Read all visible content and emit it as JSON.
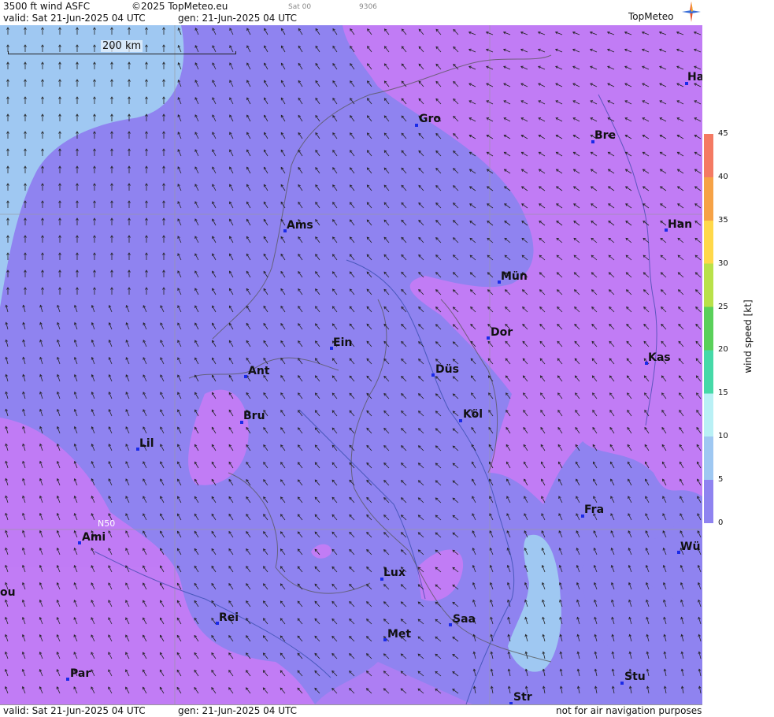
{
  "header": {
    "title": "3500 ft wind ASFC",
    "copyright": "©2025 TopMeteo.eu",
    "mini_day": "Sat 00",
    "mini_code": "9306",
    "valid": "valid:  Sat  21-Jun-2025  04 UTC",
    "gen": "gen:  21-Jun-2025 04 UTC",
    "logo": "TopMeteo"
  },
  "footer": {
    "valid": "valid:  Sat  21-Jun-2025  04 UTC",
    "gen": "gen:  21-Jun-2025 04 UTC",
    "disclaimer": "not for air navigation purposes"
  },
  "scale_bar": {
    "label": "200 km"
  },
  "grid_label": "N50",
  "legend": {
    "title": "wind  speed  [kt]",
    "ticks": [
      "45",
      "40",
      "35",
      "30",
      "25",
      "20",
      "15",
      "10",
      "5",
      "0"
    ],
    "colors": [
      "#f47a63",
      "#f6a246",
      "#ffd84a",
      "#b9e14a",
      "#5ad05a",
      "#46d9a8",
      "#b9f0f5",
      "#9fc8f2",
      "#8f83f0",
      "#c17cf5"
    ]
  },
  "cities": [
    {
      "name": "Ha",
      "id": "ha"
    },
    {
      "name": "Gro",
      "id": "gro"
    },
    {
      "name": "Bre",
      "id": "bre"
    },
    {
      "name": "Ams",
      "id": "ams"
    },
    {
      "name": "Han",
      "id": "han"
    },
    {
      "name": "Mün",
      "id": "mun"
    },
    {
      "name": "Dor",
      "id": "dor"
    },
    {
      "name": "Ein",
      "id": "ein"
    },
    {
      "name": "Kas",
      "id": "kas"
    },
    {
      "name": "Ant",
      "id": "ant"
    },
    {
      "name": "Düs",
      "id": "dus"
    },
    {
      "name": "Bru",
      "id": "bru"
    },
    {
      "name": "Köl",
      "id": "kol"
    },
    {
      "name": "Lil",
      "id": "lil"
    },
    {
      "name": "Fra",
      "id": "fra"
    },
    {
      "name": "Ami",
      "id": "ami"
    },
    {
      "name": "Wü",
      "id": "wu"
    },
    {
      "name": "Lux",
      "id": "lux"
    },
    {
      "name": "ou",
      "id": "ou"
    },
    {
      "name": "Rei",
      "id": "rei"
    },
    {
      "name": "Saa",
      "id": "saa"
    },
    {
      "name": "Met",
      "id": "met"
    },
    {
      "name": "Par",
      "id": "par"
    },
    {
      "name": "Stu",
      "id": "stu"
    },
    {
      "name": "Str",
      "id": "str"
    }
  ]
}
